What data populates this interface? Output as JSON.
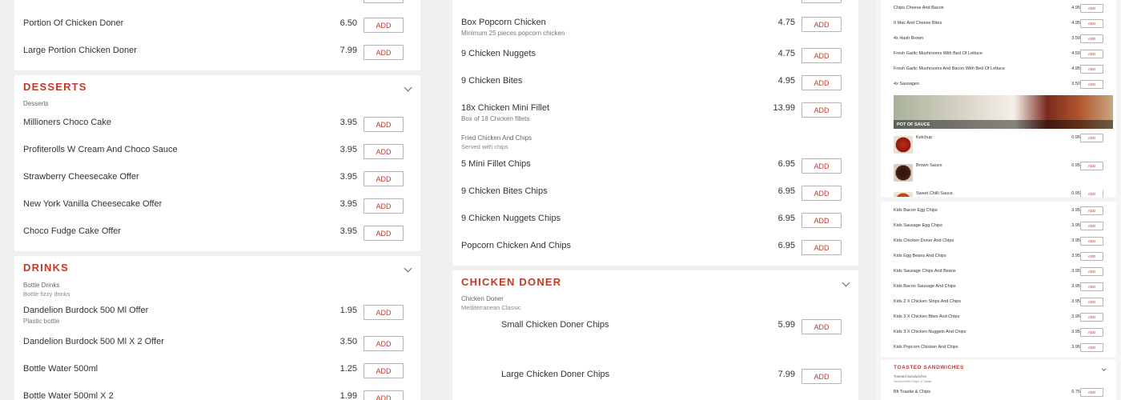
{
  "panel1": {
    "doner_items": [
      {
        "name": "Portion Of Chicken Doner",
        "price": "6.50"
      },
      {
        "name": "Large Portion Chicken Doner",
        "price": "7.99"
      }
    ],
    "desserts": {
      "title": "Desserts",
      "category": "Desserts",
      "items": [
        {
          "name": "Millioners Choco Cake",
          "price": "3.95"
        },
        {
          "name": "Profiterolls W Cream And Choco Sauce",
          "price": "3.95"
        },
        {
          "name": "Strawberry Cheesecake Offer",
          "price": "3.95"
        },
        {
          "name": "New York Vanilla Cheesecake Offer",
          "price": "3.95"
        },
        {
          "name": "Choco Fudge Cake Offer",
          "price": "3.95"
        }
      ]
    },
    "drinks": {
      "title": "Drinks",
      "category": "Bottle Drinks",
      "category_sub": "Bottle fizzy drinks",
      "items": [
        {
          "name": "Dandelion Burdock 500 Ml Offer",
          "sub": "Plastic bottle",
          "price": "1.95"
        },
        {
          "name": "Dandelion Burdock 500 Ml X 2 Offer",
          "price": "3.50"
        },
        {
          "name": "Bottle Water 500ml",
          "price": "1.25"
        },
        {
          "name": "Bottle Water 500ml X 2",
          "price": "1.99"
        }
      ]
    }
  },
  "panel2": {
    "chicken_items": [
      {
        "name": "Box Popcorn Chicken",
        "sub": "Minimum 25 pieces popcorn chicken",
        "price": "4.75"
      },
      {
        "name": "9 Chicken Nuggets",
        "price": "4.75"
      },
      {
        "name": "9 Chicken Bites",
        "price": "4.95"
      },
      {
        "name": "18x Chicken Mini Fillet",
        "sub": "Box of 18 Chicken fillets",
        "price": "13.99"
      }
    ],
    "fried_category": "Fried Chicken And Chips",
    "fried_category_sub": "Served with chips",
    "fried_items": [
      {
        "name": "5 Mini Fillet Chips",
        "price": "6.95"
      },
      {
        "name": "9 Chicken Bites Chips",
        "price": "6.95"
      },
      {
        "name": "9 Chicken Nuggets Chips",
        "price": "6.95"
      },
      {
        "name": "Popcorn Chicken And Chips",
        "price": "6.95"
      }
    ],
    "doner": {
      "title": "Chicken Doner",
      "category": "Chicken Doner",
      "category_sub": "Mediterranean Classic",
      "items": [
        {
          "name": "Small Chicken Doner Chips",
          "price": "5.99"
        },
        {
          "name": "Large Chicken Doner Chips",
          "price": "7.99"
        }
      ]
    }
  },
  "panel3": {
    "top_items": [
      {
        "name": "Chips Cheese And Bacon",
        "price": "4.95"
      },
      {
        "name": "9 Mac And Cheese Bites",
        "price": "4.95"
      },
      {
        "name": "4x Hash Brown",
        "price": "3.50"
      },
      {
        "name": "Fresh Garlic Mushrooms With Bed Of Lettuce",
        "price": "4.50"
      },
      {
        "name": "Fresh Garlic Mushrooms And Bacon With Bed Of Lettuce",
        "price": "4.95"
      },
      {
        "name": "4x Sausages",
        "price": "3.50"
      }
    ],
    "sauce_banner": "POT OF SAUCE",
    "sauces": [
      {
        "name": "Ketchup",
        "price": "0.95"
      },
      {
        "name": "Brown Sauce",
        "price": "0.95"
      },
      {
        "name": "Sweet Chilli Sauce",
        "price": "0.95"
      }
    ],
    "kids_items": [
      {
        "name": "Kids Bacon Egg Chips",
        "price": "3.95"
      },
      {
        "name": "Kids Sausage Egg Chips",
        "price": "3.95"
      },
      {
        "name": "Kids Chicken Doner And Chips",
        "price": "3.95"
      },
      {
        "name": "Kids Egg Beans And Chips",
        "price": "3.95"
      },
      {
        "name": "Kids Sausage Chips And Beans",
        "price": "3.95"
      },
      {
        "name": "Kids Bacon Sausage And Chips",
        "price": "3.95"
      },
      {
        "name": "Kids 2 X Chicken Strips And Chips",
        "price": "3.95"
      },
      {
        "name": "Kids 3 X Chicken Bites And Chips",
        "price": "3.95"
      },
      {
        "name": "Kids 3 X Chicken Nuggets And Chips",
        "price": "3.95"
      },
      {
        "name": "Kids Popcorn Chicken And Chips",
        "price": "3.95"
      }
    ],
    "toasted": {
      "title": "Toasted Sandwiches",
      "category": "Toasted Sandwiches",
      "category_sub": "Served with Chips & Salad",
      "items": [
        {
          "name": "Blt Toastie & Chips",
          "price": "6.75"
        }
      ]
    }
  },
  "add_label": "ADD",
  "colors": {
    "accent": "#c0392b",
    "background": "#f0f0f0",
    "card": "#ffffff"
  }
}
